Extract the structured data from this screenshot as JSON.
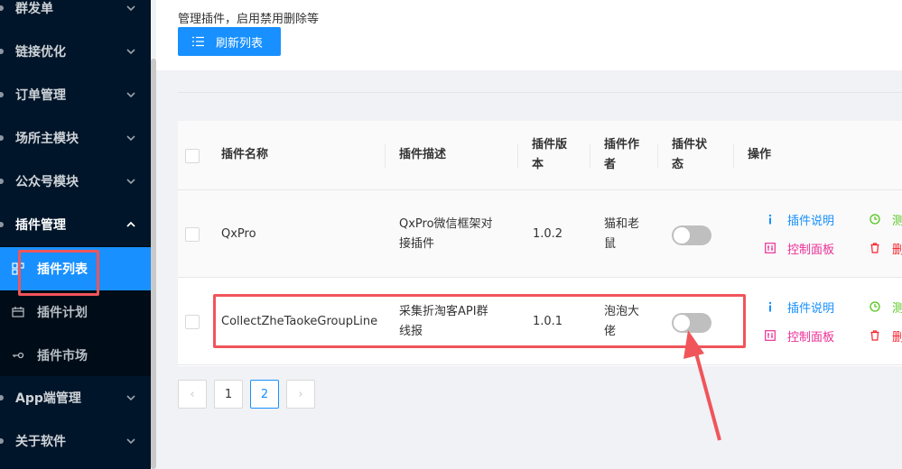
{
  "sidebar": {
    "items": [
      {
        "label": "群发单"
      },
      {
        "label": "链接优化"
      },
      {
        "label": "订单管理"
      },
      {
        "label": "场所主模块"
      },
      {
        "label": "公众号模块"
      },
      {
        "label": "插件管理"
      },
      {
        "label": "App端管理"
      },
      {
        "label": "关于软件"
      }
    ],
    "subitems": [
      {
        "label": "插件列表",
        "icon": "grid-icon"
      },
      {
        "label": "插件计划",
        "icon": "calendar-icon"
      },
      {
        "label": "插件市场",
        "icon": "key-icon"
      }
    ]
  },
  "header": {
    "description": "管理插件，启用禁用删除等",
    "refresh_label": "刷新列表"
  },
  "table": {
    "columns": {
      "name": "插件名称",
      "desc": "插件描述",
      "version_l1": "插件版",
      "version_l2": "本",
      "author_l1": "插件作",
      "author_l2": "者",
      "status_l1": "插件状",
      "status_l2": "态",
      "ops": "操作"
    },
    "rows": [
      {
        "name": "QxPro",
        "desc_l1": "QxPro微信框架对",
        "desc_l2": "接插件",
        "version": "1.0.2",
        "author_l1": "猫和老",
        "author_l2": "鼠",
        "enabled": false,
        "op_info": "插件说明",
        "op_panel": "控制面板",
        "op_test": "测",
        "op_delete": "删"
      },
      {
        "name": "CollectZheTaokeGroupLine",
        "desc_l1": "采集折淘客API群",
        "desc_l2": "线报",
        "version": "1.0.1",
        "author_l1": "泡泡大",
        "author_l2": "佬",
        "enabled": false,
        "op_info": "插件说明",
        "op_panel": "控制面板",
        "op_test": "测",
        "op_delete": "删"
      }
    ]
  },
  "pagination": {
    "pages": [
      "1",
      "2"
    ],
    "current": "2",
    "prev_label": "‹",
    "next_label": "›"
  },
  "colors": {
    "sidebar_bg": "#001529",
    "primary": "#1890ff",
    "annotation": "#f0555a"
  }
}
